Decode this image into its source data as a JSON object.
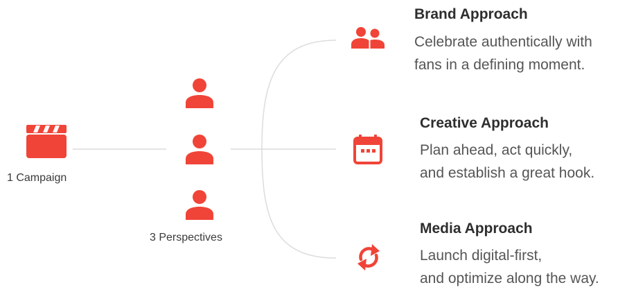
{
  "campaign": {
    "label": "1 Campaign",
    "icon": "clapperboard-icon"
  },
  "perspectives": {
    "label": "3 Perspectives",
    "icons": [
      "person-icon",
      "person-icon",
      "person-icon"
    ]
  },
  "approaches": [
    {
      "title": "Brand Approach",
      "icon": "people-icon",
      "description_lines": [
        "Celebrate authentically with",
        "fans in a defining moment."
      ]
    },
    {
      "title": "Creative Approach",
      "icon": "calendar-icon",
      "description_lines": [
        "Plan ahead, act quickly,",
        "and establish a great hook."
      ]
    },
    {
      "title": "Media Approach",
      "icon": "refresh-icon",
      "description_lines": [
        "Launch digital-first,",
        "and optimize along the way."
      ]
    }
  ],
  "colors": {
    "accent": "#f04438",
    "connector": "#dcdcdc",
    "text": "#555555"
  }
}
